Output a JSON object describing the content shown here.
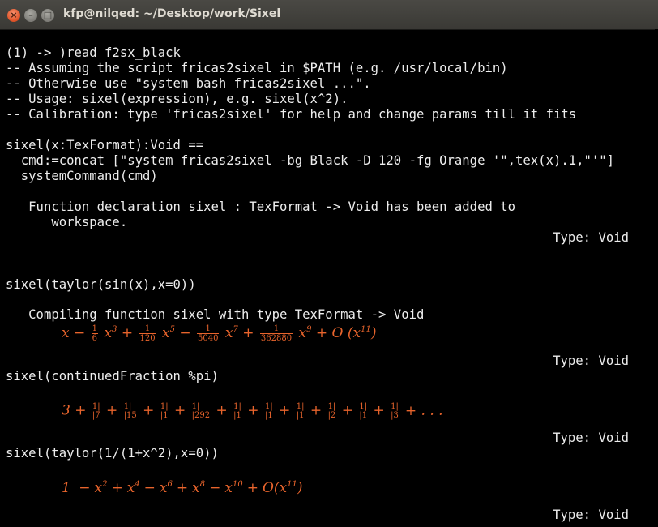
{
  "window": {
    "title": "kfp@nilqed: ~/Desktop/work/Sixel"
  },
  "terminal": {
    "lines": {
      "l1": "(1) -> )read f2sx_black",
      "l2": "-- Assuming the script fricas2sixel in $PATH (e.g. /usr/local/bin)",
      "l3": "-- Otherwise use \"system bash fricas2sixel ...\".",
      "l4": "-- Usage: sixel(expression), e.g. sixel(x^2).",
      "l5": "-- Calibration: type 'fricas2sixel' for help and change params till it fits",
      "l6": "sixel(x:TexFormat):Void ==",
      "l7": "  cmd:=concat [\"system fricas2sixel -bg Black -D 120 -fg Orange '\",tex(x).1,\"'\"]",
      "l8": "  systemCommand(cmd)",
      "l9": "   Function declaration sixel : TexFormat -> Void has been added to",
      "l10": "      workspace.",
      "l11": "sixel(taylor(sin(x),x=0))",
      "l12": "   Compiling function sixel with type TexFormat -> Void",
      "l13": "sixel(continuedFraction %pi)",
      "l14": "sixel(taylor(1/(1+x^2),x=0))"
    },
    "type_void": "Type: Void",
    "math": {
      "sin_series": {
        "x": "x",
        "minus": "−",
        "plus": "+",
        "one": "1",
        "d6": "6",
        "d120": "120",
        "d5040": "5040",
        "d362880": "362880",
        "x3": "x",
        "e3": "3",
        "x5": "x",
        "e5": "5",
        "x7": "x",
        "e7": "7",
        "x9": "x",
        "e9": "9",
        "big_o": "O",
        "lp": "(",
        "rp": ")",
        "x11": "x",
        "e11": "11"
      },
      "pi_cf": {
        "three": "3",
        "terms": [
          "7",
          "15",
          "1",
          "292",
          "1",
          "1",
          "1",
          "2",
          "1",
          "3"
        ],
        "numer": "1|",
        "bar": "|",
        "dots": "+ . . ."
      },
      "inv_series": {
        "one": "1",
        "terms": [
          {
            "op": "−",
            "base": "x",
            "exp": "2"
          },
          {
            "op": "+",
            "base": "x",
            "exp": "4"
          },
          {
            "op": "−",
            "base": "x",
            "exp": "6"
          },
          {
            "op": "+",
            "base": "x",
            "exp": "8"
          },
          {
            "op": "−",
            "base": "x",
            "exp": "10"
          }
        ],
        "tail": {
          "op": "+",
          "big_o": "O",
          "lp": "(",
          "base": "x",
          "exp": "11",
          "rp": ")"
        }
      }
    },
    "colors": {
      "background": "#000000",
      "text": "#ededed",
      "math": "#e8642c"
    }
  }
}
